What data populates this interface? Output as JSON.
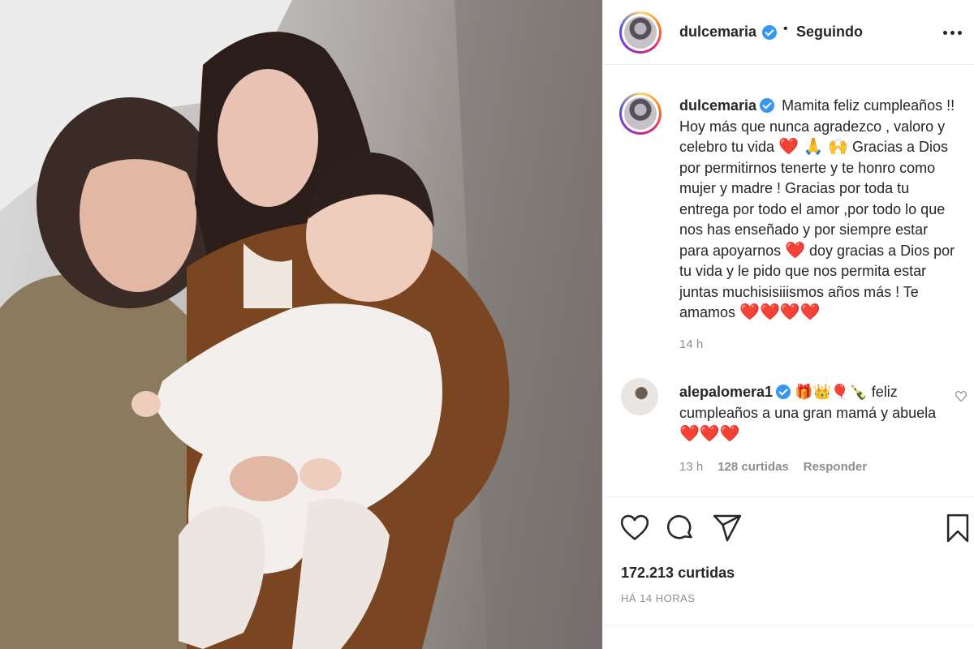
{
  "header": {
    "username": "dulcemaria",
    "separator": "•",
    "follow_state": "Seguindo",
    "avatar_icon": "profile-avatar-icon",
    "verified_icon": "verified-badge-icon",
    "more_icon": "more-options-icon"
  },
  "caption": {
    "username": "dulcemaria",
    "text_1": "Mamita feliz cumpleaños !! Hoy más que nunca agradezco , valoro y celebro tu vida",
    "emoji_1": "❤️ 🙏 🙌",
    "text_2": "Gracias a Dios por permitirnos tenerte y te honro como mujer y madre ! Gracias por toda tu entrega por todo el amor ,por todo lo que nos has enseñado y por siempre estar para apoyarnos",
    "emoji_2": "❤️",
    "text_3": "doy gracias a Dios por tu vida y le pido que nos permita estar juntas muchisisiiismos años más ! Te amamos",
    "emoji_3": "❤️❤️❤️❤️",
    "time": "14 h"
  },
  "comment": {
    "username": "alepalomera1",
    "emoji_1": "🎁👑🎈🍾",
    "text": "feliz cumpleaños a una gran mamá y abuela",
    "emoji_2": "❤️❤️❤️",
    "time": "13 h",
    "likes": "128 curtidas",
    "reply": "Responder"
  },
  "actions": {
    "like_icon": "heart-outline-icon",
    "comment_icon": "comment-bubble-icon",
    "share_icon": "paper-plane-icon",
    "save_icon": "bookmark-icon"
  },
  "likes_count": "172.213 curtidas",
  "post_date": "HÁ 14 HORAS",
  "colors": {
    "verified": "#3897f0",
    "text": "#262626",
    "muted": "#8e8e8e",
    "heart": "#e0245e"
  }
}
